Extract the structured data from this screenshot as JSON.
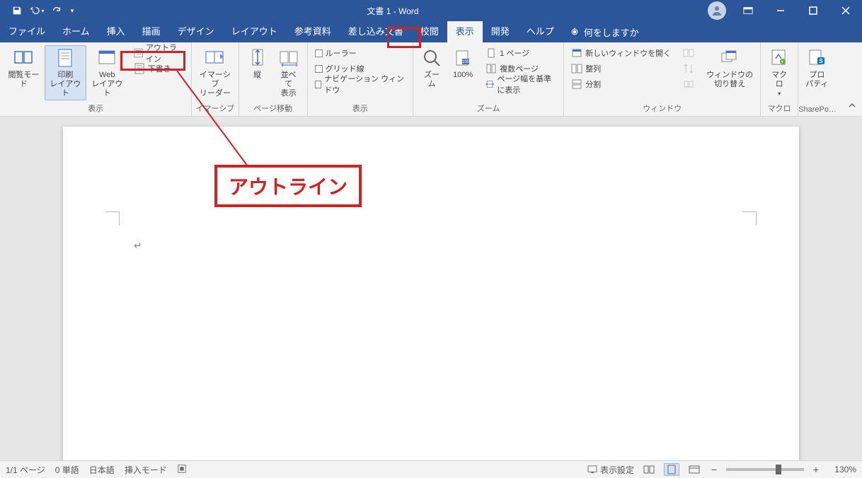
{
  "title": "文書 1 - Word",
  "tabs": {
    "file": "ファイル",
    "home": "ホーム",
    "insert": "挿入",
    "draw": "描画",
    "design": "デザイン",
    "layout": "レイアウト",
    "references": "参考資料",
    "mailings": "差し込み文書",
    "review": "校閲",
    "view": "表示",
    "developer": "開発",
    "help": "ヘルプ"
  },
  "tellme": "何をしますか",
  "ribbon": {
    "group_views": "表示",
    "group_immersive": "イマーシブ",
    "group_pagemove": "ページ移動",
    "group_show": "表示",
    "group_zoom": "ズーム",
    "group_window": "ウィンドウ",
    "group_macros": "マクロ",
    "group_sharepoint": "SharePo…",
    "read_mode": "閲覧モード",
    "print_layout": "印刷\nレイアウト",
    "web_layout": "Web\nレイアウト",
    "outline": "アウトライン",
    "draft": "下書き",
    "immersive_reader": "イマーシブ\nリーダー",
    "vertical": "縦",
    "side_by_side": "並べて\n表示",
    "ruler": "ルーラー",
    "gridlines": "グリッド線",
    "nav_pane": "ナビゲーション ウィンドウ",
    "zoom": "ズーム",
    "hundred": "100%",
    "one_page": "1 ページ",
    "multi_page": "複数ページ",
    "page_width": "ページ幅を基準に表示",
    "new_window": "新しいウィンドウを開く",
    "arrange_all": "整列",
    "split": "分割",
    "switch_windows": "ウィンドウの\n切り替え",
    "macros": "マクロ",
    "properties": "プロ\nパティ"
  },
  "callout": "アウトライン",
  "status": {
    "page": "1/1 ページ",
    "words": "0 単語",
    "lang": "日本語",
    "insert_mode": "挿入モード",
    "display_settings": "表示設定",
    "zoom_pct": "130%"
  }
}
